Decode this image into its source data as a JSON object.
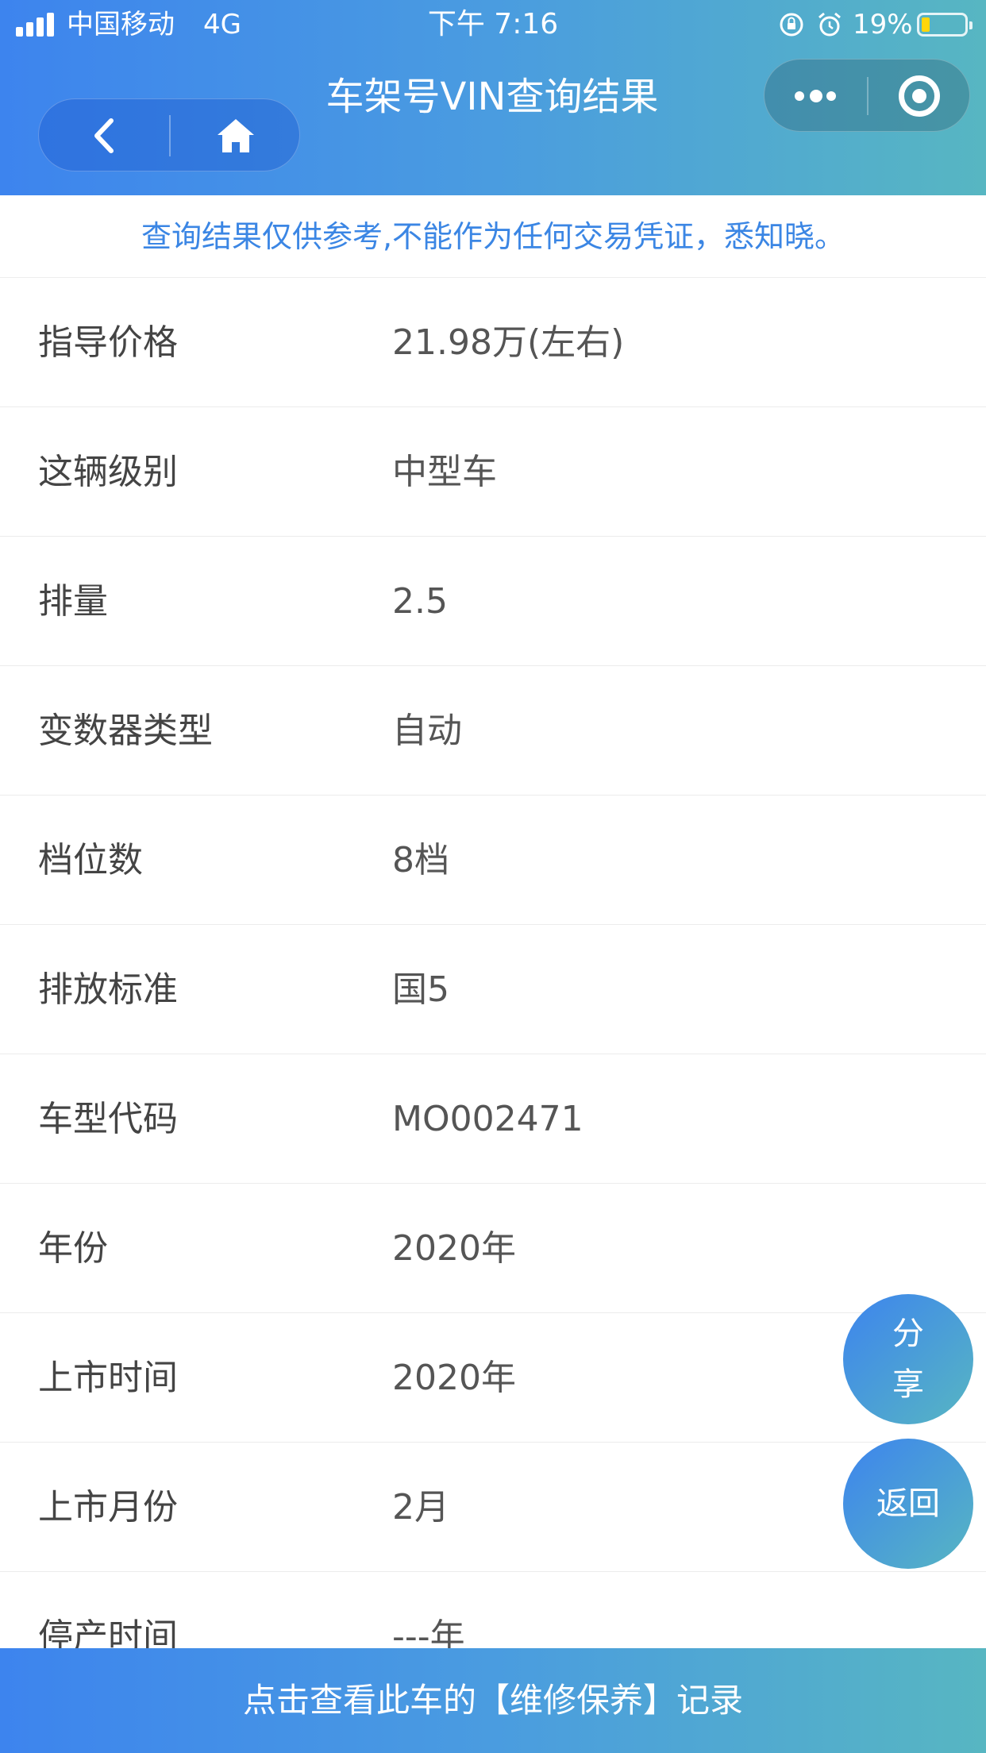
{
  "status_bar": {
    "carrier": "中国移动",
    "network": "4G",
    "time": "下午 7:16",
    "battery_percent": "19%",
    "battery_level": 0.19
  },
  "nav": {
    "title": "车架号VIN查询结果",
    "back_icon": "chevron-left-icon",
    "home_icon": "home-icon",
    "more_icon": "more-dots-icon",
    "close_icon": "target-icon"
  },
  "notice": "查询结果仅供参考,不能作为任何交易凭证，悉知晓。",
  "rows": [
    {
      "label": "指导价格",
      "value": "21.98万(左右)"
    },
    {
      "label": "这辆级别",
      "value": "中型车"
    },
    {
      "label": "排量",
      "value": "2.5"
    },
    {
      "label": "变数器类型",
      "value": "自动"
    },
    {
      "label": "档位数",
      "value": "8档"
    },
    {
      "label": "排放标准",
      "value": "国5"
    },
    {
      "label": "车型代码",
      "value": "MO002471"
    },
    {
      "label": "年份",
      "value": "2020年"
    },
    {
      "label": "上市时间",
      "value": "2020年"
    },
    {
      "label": "上市月份",
      "value": "2月"
    },
    {
      "label": "停产时间",
      "value": "---年"
    }
  ],
  "floating": {
    "share_char_1": "分",
    "share_char_2": "享",
    "return_label": "返回"
  },
  "footer": "点击查看此车的【维修保养】记录",
  "colors": {
    "accent_start": "#3d84ee",
    "accent_end": "#57b6c2",
    "notice_text": "#3b86e4"
  }
}
